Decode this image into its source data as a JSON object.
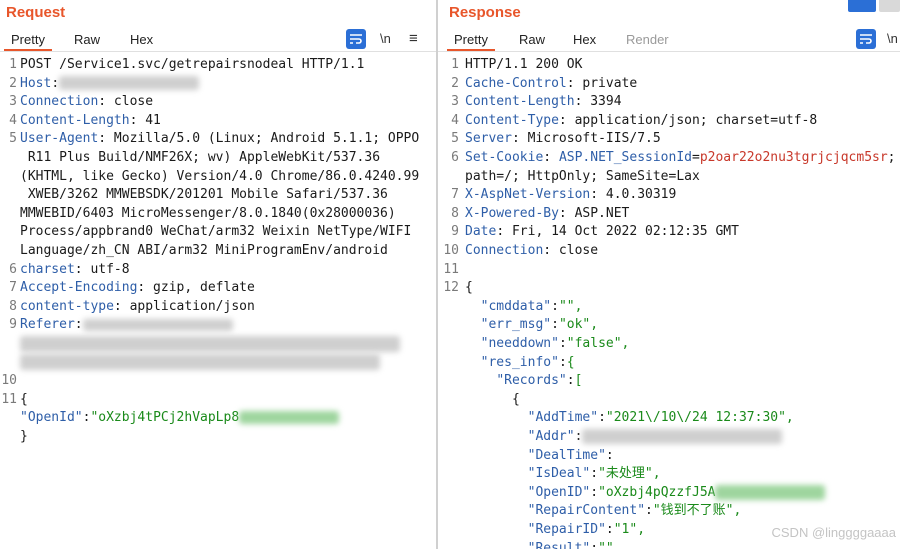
{
  "request": {
    "title": "Request",
    "tabs": [
      "Pretty",
      "Raw",
      "Hex"
    ],
    "tools": {
      "newline_label": "\\n",
      "menu_label": "≡"
    },
    "lines": [
      {
        "n": "1",
        "text": "POST /Service1.svc/getrepairsnodeal HTTP/1.1"
      },
      {
        "n": "2",
        "key": "Host",
        "value": ""
      },
      {
        "n": "3",
        "key": "Connection",
        "value": " close"
      },
      {
        "n": "4",
        "key": "Content-Length",
        "value": " 41"
      },
      {
        "n": "5",
        "key": "User-Agent",
        "value": " Mozilla/5.0 (Linux; Android 5.1.1; OPPO"
      },
      {
        "n": "",
        "text": " R11 Plus Build/NMF26X; wv) AppleWebKit/537.36"
      },
      {
        "n": "",
        "text": "(KHTML, like Gecko) Version/4.0 Chrome/86.0.4240.99"
      },
      {
        "n": "",
        "text": " XWEB/3262 MMWEBSDK/201201 Mobile Safari/537.36"
      },
      {
        "n": "",
        "text": "MMWEBID/6403 MicroMessenger/8.0.1840(0x28000036)"
      },
      {
        "n": "",
        "text": "Process/appbrand0 WeChat/arm32 Weixin NetType/WIFI"
      },
      {
        "n": "",
        "text": "Language/zh_CN ABI/arm32 MiniProgramEnv/android"
      },
      {
        "n": "6",
        "key": "charset",
        "value": " utf-8"
      },
      {
        "n": "7",
        "key": "Accept-Encoding",
        "value": " gzip, deflate"
      },
      {
        "n": "8",
        "key": "content-type",
        "value": " application/json"
      },
      {
        "n": "9",
        "key": "Referer",
        "value": ""
      },
      {
        "n": "",
        "text": ""
      },
      {
        "n": "",
        "text": ""
      },
      {
        "n": "10",
        "text": ""
      },
      {
        "n": "11",
        "text": "{"
      },
      {
        "n": "",
        "jkey": "\"OpenId\"",
        "jval": "\"oXzbj4tPCj2hVapLp8"
      },
      {
        "n": "",
        "text": "}"
      }
    ]
  },
  "response": {
    "title": "Response",
    "tabs": [
      "Pretty",
      "Raw",
      "Hex",
      "Render"
    ],
    "tools": {
      "newline_label": "\\n"
    },
    "lines": [
      {
        "n": "1",
        "text": "HTTP/1.1 200 OK"
      },
      {
        "n": "2",
        "key": "Cache-Control",
        "value": " private"
      },
      {
        "n": "3",
        "key": "Content-Length",
        "value": " 3394"
      },
      {
        "n": "4",
        "key": "Content-Type",
        "value": " application/json; charset=utf-8"
      },
      {
        "n": "5",
        "key": "Server",
        "value": " Microsoft-IIS/7.5"
      },
      {
        "n": "6",
        "key": "Set-Cookie",
        "value": " ",
        "cookie_name": "ASP.NET_SessionId",
        "cookie_eq": "=",
        "cookie_val": "p2oar22o2nu3tgrjcjqcm5sr",
        "cookie_end": ";"
      },
      {
        "n": "",
        "text": "path=/; HttpOnly; SameSite=Lax"
      },
      {
        "n": "7",
        "key": "X-AspNet-Version",
        "value": " 4.0.30319"
      },
      {
        "n": "8",
        "key": "X-Powered-By",
        "value": " ASP.NET"
      },
      {
        "n": "9",
        "key": "Date",
        "value": " Fri, 14 Oct 2022 02:12:35 GMT"
      },
      {
        "n": "10",
        "key": "Connection",
        "value": " close"
      },
      {
        "n": "11",
        "text": ""
      },
      {
        "n": "12",
        "text": "{"
      },
      {
        "n": "",
        "indent": "  ",
        "jkey": "\"cmddata\"",
        "jval": "\"\","
      },
      {
        "n": "",
        "indent": "  ",
        "jkey": "\"err_msg\"",
        "jval": "\"ok\","
      },
      {
        "n": "",
        "indent": "  ",
        "jkey": "\"needdown\"",
        "jval": "\"false\","
      },
      {
        "n": "",
        "indent": "  ",
        "jkey": "\"res_info\"",
        "jval": "{"
      },
      {
        "n": "",
        "indent": "    ",
        "jkey": "\"Records\"",
        "jval": "["
      },
      {
        "n": "",
        "indent": "      ",
        "text": "{"
      },
      {
        "n": "",
        "indent": "        ",
        "jkey": "\"AddTime\"",
        "jval": "\"2021\\/10\\/24 12:37:30\","
      },
      {
        "n": "",
        "indent": "        ",
        "jkey": "\"Addr\"",
        "jval": ""
      },
      {
        "n": "",
        "indent": "        ",
        "jkey": "\"DealTime\"",
        "jval": ""
      },
      {
        "n": "",
        "indent": "        ",
        "jkey": "\"IsDeal\"",
        "jval": "\"未处理\","
      },
      {
        "n": "",
        "indent": "        ",
        "jkey": "\"OpenID\"",
        "jval": "\"oXzbj4pQzzfJ5A"
      },
      {
        "n": "",
        "indent": "        ",
        "jkey": "\"RepairContent\"",
        "jval": "\"钱到不了账\","
      },
      {
        "n": "",
        "indent": "        ",
        "jkey": "\"RepairID\"",
        "jval": "\"1\","
      },
      {
        "n": "",
        "indent": "        ",
        "jkey": "\"Result\"",
        "jval": "\"\""
      }
    ]
  },
  "watermark": "CSDN @linggggaaaa",
  "colors": {
    "accent": "#e8562b",
    "key": "#2e5ea8",
    "string": "#1a8a1a",
    "cookie_value": "#c8382a",
    "button": "#2b6fd6"
  }
}
